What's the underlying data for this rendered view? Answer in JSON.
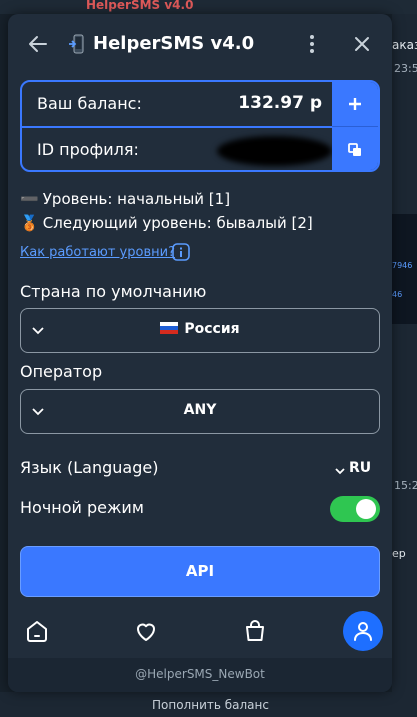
{
  "background": {
    "top_title": "HelperSMS v4.0",
    "right_texts": [
      "аказ",
      "23:5",
      "7946",
      "46",
      "15:2",
      "ер"
    ],
    "bottom_text": "Пополнить баланс"
  },
  "header": {
    "title": "HelperSMS v4.0",
    "icons": [
      "back-arrow-icon",
      "phone-icon",
      "kebab-menu-icon",
      "close-icon"
    ]
  },
  "balance": {
    "label": "Ваш баланс:",
    "value": "132.97 р",
    "profile_label": "ID профиля:",
    "add_icon": "plus-icon",
    "copy_icon": "copy-icon"
  },
  "level": {
    "current": "Уровень: начальный [1]",
    "next": "Следующий уровень: бывалый [2]",
    "current_emoji": "➖",
    "next_emoji": "🥉",
    "how_link": "Как работают уровни?"
  },
  "country": {
    "label": "Страна по умолчанию",
    "value": "Россия"
  },
  "operator": {
    "label": "Оператор",
    "value": "ANY"
  },
  "language": {
    "label": "Язык (Language)",
    "value": "RU"
  },
  "night_mode": {
    "label": "Ночной режим",
    "enabled": true
  },
  "api_button": {
    "label": "API"
  },
  "bottom_nav": {
    "items": [
      "home-icon",
      "heart-icon",
      "bag-icon",
      "profile-icon"
    ],
    "active": "profile-icon"
  },
  "footer": {
    "text": "@HelperSMS_NewBot"
  },
  "colors": {
    "accent": "#3a78ff",
    "toggle_on": "#2fc651",
    "panel": "#212d3b",
    "link": "#5b9cff"
  }
}
